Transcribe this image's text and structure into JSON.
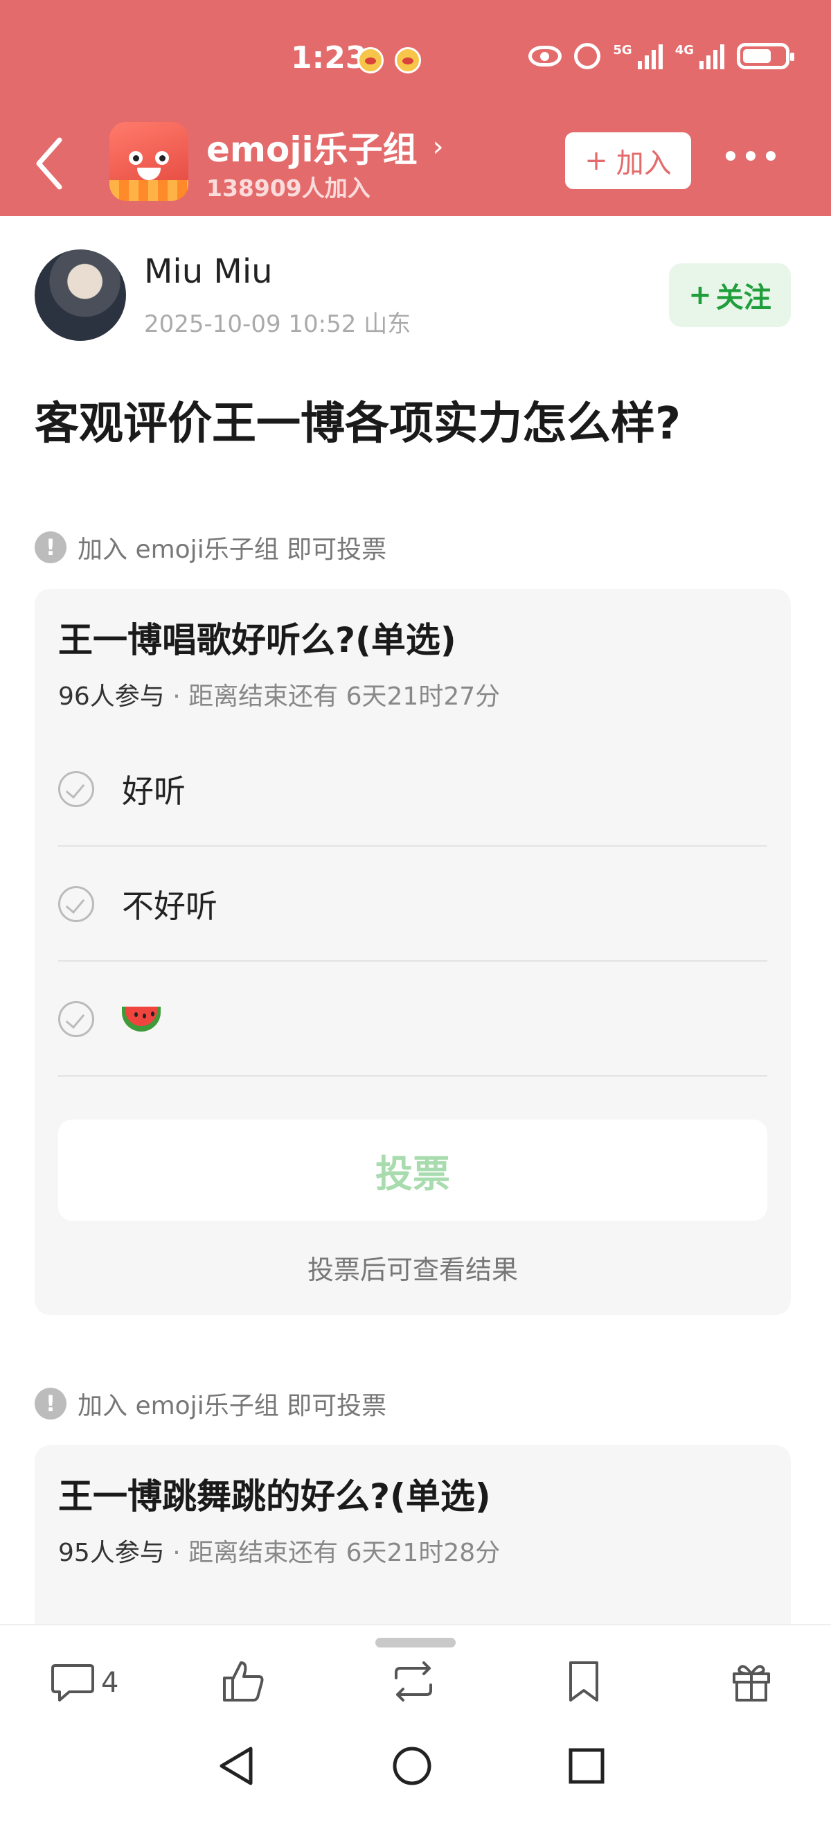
{
  "status_bar": {
    "time": "1:23",
    "network_5g": "5G",
    "network_4g": "4G"
  },
  "header": {
    "group_name": "emoji乐子组",
    "chevron": "›",
    "member_count": "138909人加入",
    "join_label": "加入",
    "join_plus": "+"
  },
  "post": {
    "author_name": "Miu Miu",
    "meta": "2025-10-09 10:52  山东",
    "follow_plus": "+",
    "follow_label": "关注",
    "title": "客观评价王一博各项实力怎么样?"
  },
  "polls": [
    {
      "hint": "加入 emoji乐子组 即可投票",
      "question": "王一博唱歌好听么?(单选)",
      "participants": "96人参与",
      "separator": " · ",
      "deadline": "距离结束还有 6天21时27分",
      "options": [
        "好听",
        "不好听",
        "watermelon-emoji"
      ],
      "vote_label": "投票",
      "result_hint": "投票后可查看结果"
    },
    {
      "hint": "加入 emoji乐子组 即可投票",
      "question": "王一博跳舞跳的好么?(单选)",
      "participants": "95人参与",
      "separator": " · ",
      "deadline": "距离结束还有 6天21时28分"
    }
  ],
  "action_bar": {
    "comment_count": "4",
    "icons": [
      "comment-icon",
      "like-icon",
      "repost-icon",
      "bookmark-icon",
      "gift-icon"
    ]
  },
  "nav_bar": {
    "icons": [
      "back-triangle-icon",
      "home-circle-icon",
      "recents-square-icon"
    ]
  },
  "colors": {
    "header_bg": "#e46b6b",
    "follow_green": "#1f9e3b",
    "vote_disabled": "#a8dcae"
  }
}
